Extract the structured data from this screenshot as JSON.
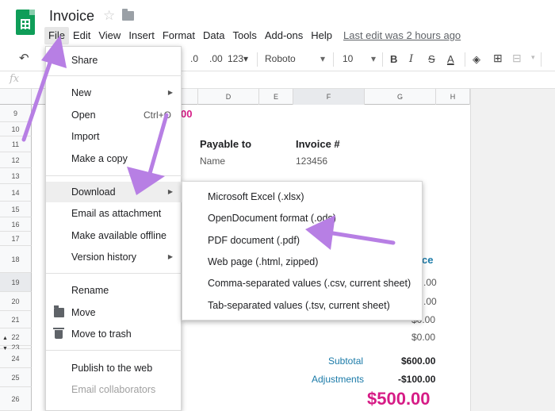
{
  "header": {
    "title": "Invoice",
    "star_icon": "star-icon",
    "folder_icon": "folder-icon",
    "menus": [
      "File",
      "Edit",
      "View",
      "Insert",
      "Format",
      "Data",
      "Tools",
      "Add-ons",
      "Help"
    ],
    "last_edit": "Last edit was 2 hours ago"
  },
  "toolbar": {
    "decimal_less": ".0",
    "decimal_more": ".00",
    "number_format": "123",
    "font": "Roboto",
    "font_size": "10",
    "bold": "B",
    "italic": "I",
    "strike": "S",
    "text_color": "A"
  },
  "formula_bar": {
    "fx": "fx"
  },
  "grid": {
    "columns": [
      "D",
      "E",
      "F",
      "G",
      "H"
    ],
    "rows": [
      "9",
      "10",
      "11",
      "12",
      "13",
      "14",
      "15",
      "16",
      "17",
      "18",
      "19",
      "20",
      "21",
      "22",
      "23",
      "24",
      "25",
      "26"
    ],
    "cells": {
      "total_due_fragment": "00",
      "payable_to": "Payable to",
      "name": "Name",
      "invoice_no_label": "Invoice #",
      "invoice_no": "123456",
      "invoice_fragment": "ce",
      "r19": ".00",
      "r20": ".00",
      "r21": "$0.00",
      "r22": "$0.00",
      "subtotal_label": "Subtotal",
      "subtotal_value": "$600.00",
      "adjustments_label": "Adjustments",
      "adjustments_value": "-$100.00",
      "total": "$500.00"
    }
  },
  "file_menu": {
    "share": "Share",
    "new": "New",
    "open": "Open",
    "open_shortcut": "Ctrl+O",
    "import": "Import",
    "make_copy": "Make a copy",
    "download": "Download",
    "email_attachment": "Email as attachment",
    "offline": "Make available offline",
    "version_history": "Version history",
    "rename": "Rename",
    "move": "Move",
    "trash": "Move to trash",
    "publish": "Publish to the web",
    "email_collaborators": "Email collaborators"
  },
  "download_menu": {
    "items": [
      "Microsoft Excel (.xlsx)",
      "OpenDocument format (.ods)",
      "PDF document (.pdf)",
      "Web page (.html, zipped)",
      "Comma-separated values (.csv, current sheet)",
      "Tab-separated values (.tsv, current sheet)"
    ]
  },
  "colors": {
    "accent_pink": "#d61c86",
    "annotation_purple": "#b77fe4",
    "sheets_green": "#0f9d58"
  }
}
